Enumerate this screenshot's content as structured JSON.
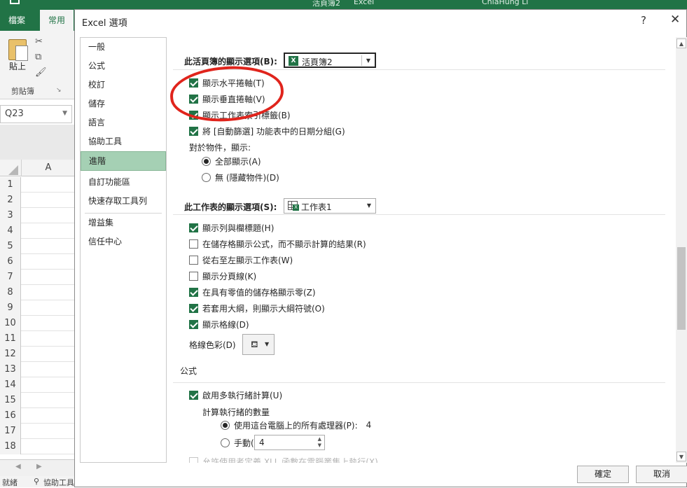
{
  "excel": {
    "title_doc": "活頁簿2",
    "title_app": "Excel",
    "title_user": "ChiaHung Li",
    "tabs": [
      "檔案",
      "常用"
    ],
    "paste_label": "貼上",
    "clipboard_group": "剪貼簿",
    "namebox": "Q23",
    "column": "A",
    "rows": [
      "1",
      "2",
      "3",
      "4",
      "5",
      "6",
      "7",
      "8",
      "9",
      "10",
      "11",
      "12",
      "13",
      "14",
      "15",
      "16",
      "17",
      "18"
    ],
    "status": "就緒",
    "status_accessibility": "協助工具"
  },
  "dialog": {
    "title": "Excel 選項",
    "help": "?",
    "close": "✕",
    "nav": [
      "一般",
      "公式",
      "校訂",
      "儲存",
      "語言",
      "協助工具",
      "進階",
      "自訂功能區",
      "快速存取工具列",
      "增益集",
      "信任中心"
    ],
    "active_nav": "進階",
    "workbook_section": {
      "label": "此活頁簿的顯示選項(B):",
      "selected": "活頁簿2",
      "options": [
        {
          "label": "顯示水平捲軸(T)",
          "checked": true
        },
        {
          "label": "顯示垂直捲軸(V)",
          "checked": true
        },
        {
          "label": "顯示工作表索引標籤(B)",
          "checked": true
        },
        {
          "label": "將 [自動篩選] 功能表中的日期分組(G)",
          "checked": true
        }
      ],
      "objects_label": "對於物件，顯示:",
      "objects_options": [
        {
          "label": "全部顯示(A)",
          "selected": true
        },
        {
          "label": "無 (隱藏物件)(D)",
          "selected": false
        }
      ]
    },
    "worksheet_section": {
      "label": "此工作表的顯示選項(S):",
      "selected": "工作表1",
      "options": [
        {
          "label": "顯示列與欄標題(H)",
          "checked": true
        },
        {
          "label": "在儲存格顯示公式，而不顯示計算的結果(R)",
          "checked": false
        },
        {
          "label": "從右至左顯示工作表(W)",
          "checked": false
        },
        {
          "label": "顯示分頁線(K)",
          "checked": false
        },
        {
          "label": "在具有零值的儲存格顯示零(Z)",
          "checked": true
        },
        {
          "label": "若套用大綱，則顯示大綱符號(O)",
          "checked": true
        },
        {
          "label": "顯示格線(D)",
          "checked": true
        }
      ],
      "gridline_color_label": "格線色彩(D)"
    },
    "formula_section": {
      "label": "公式",
      "multithread": {
        "label": "啟用多執行緒計算(U)",
        "checked": true
      },
      "threads_label": "計算執行緒的數量",
      "use_all": {
        "label": "使用這台電腦上的所有處理器(P):",
        "value": "4",
        "selected": true
      },
      "manual": {
        "label": "手動(M)",
        "value": "4",
        "selected": false
      },
      "cutoff": "允許使用者定義 XLL 函數在電腦叢集上執行(X)"
    },
    "ok": "確定",
    "cancel": "取消"
  }
}
